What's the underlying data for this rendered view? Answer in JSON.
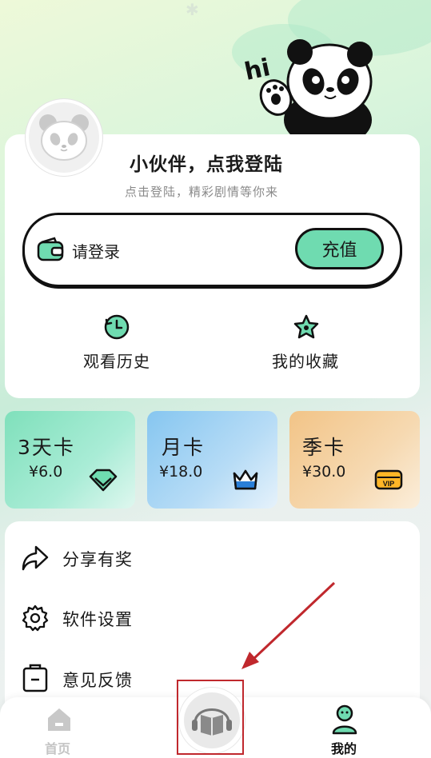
{
  "header": {
    "greeting_text": "hi"
  },
  "profile": {
    "title": "小伙伴，点我登陆",
    "subtitle": "点击登陆，精彩剧情等你来"
  },
  "wallet": {
    "label": "请登录",
    "recharge_label": "充值"
  },
  "quick_links": [
    {
      "label": "观看历史",
      "icon": "history-icon"
    },
    {
      "label": "我的收藏",
      "icon": "star-icon"
    }
  ],
  "vip_cards": [
    {
      "name": "3天卡",
      "price": "¥6.0",
      "icon": "diamond-icon",
      "color": "#8fe3c3"
    },
    {
      "name": "月卡",
      "price": "¥18.0",
      "icon": "crown-icon",
      "color": "#a4d3f3"
    },
    {
      "name": "季卡",
      "price": "¥30.0",
      "icon": "vip-ticket-icon",
      "color": "#f4cf9d"
    }
  ],
  "vip_ticket_text": "VIP",
  "menu": [
    {
      "label": "分享有奖",
      "icon": "share-icon"
    },
    {
      "label": "软件设置",
      "icon": "gear-icon"
    },
    {
      "label": "意见反馈",
      "icon": "feedback-icon"
    }
  ],
  "tabbar": {
    "home_label": "首页",
    "mine_label": "我的"
  },
  "colors": {
    "accent": "#6fdbb0",
    "annotation": "#c0282d"
  }
}
